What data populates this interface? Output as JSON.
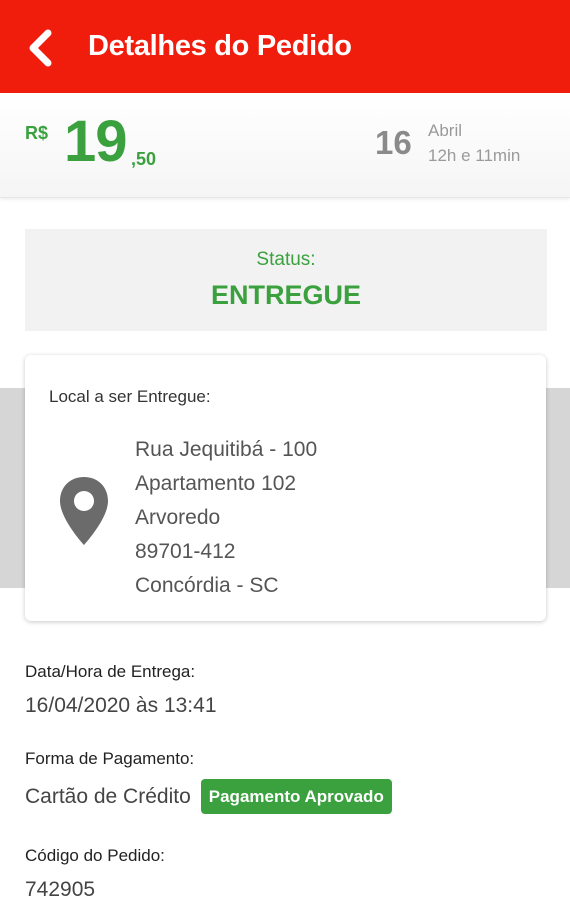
{
  "header": {
    "title": "Detalhes do Pedido"
  },
  "summary": {
    "currency": "R$",
    "price_integer": "19",
    "price_decimal": ",50",
    "day": "16",
    "month": "Abril",
    "time": "12h e 11min"
  },
  "status": {
    "label": "Status:",
    "value": "ENTREGUE"
  },
  "address": {
    "title": "Local a ser Entregue:",
    "lines": [
      "Rua Jequitibá - 100",
      "Apartamento 102",
      "Arvoredo",
      "89701-412",
      "Concórdia - SC"
    ]
  },
  "delivery": {
    "label": "Data/Hora de Entrega:",
    "value": "16/04/2020 às 13:41"
  },
  "payment": {
    "label": "Forma de Pagamento:",
    "value": "Cartão de Crédito",
    "badge": "Pagamento Aprovado"
  },
  "order_code": {
    "label": "Código do Pedido:",
    "value": "742905"
  },
  "icons": {
    "back": "arrow-left-icon",
    "location": "map-pin-icon"
  },
  "colors": {
    "app_bar": "#f01c0c",
    "accent_green": "#3aa13e",
    "status_bg": "#f2f2f2"
  }
}
